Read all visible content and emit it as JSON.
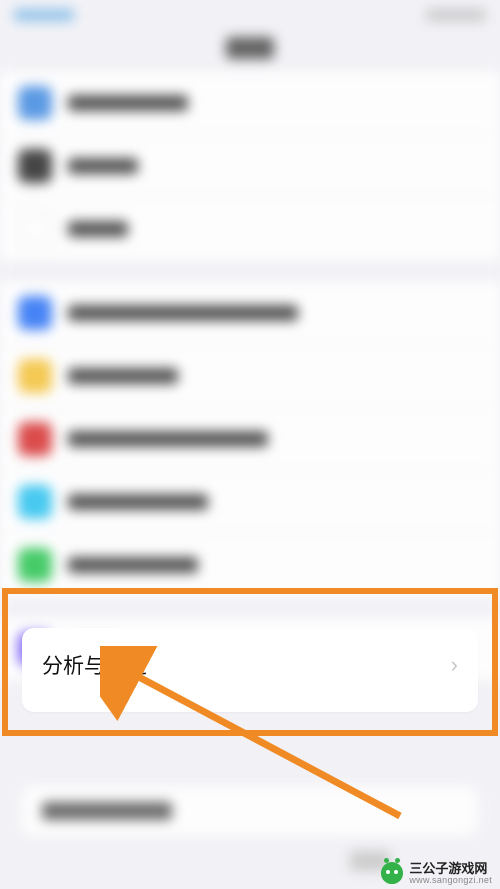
{
  "highlighted_item": {
    "label": "分析与改进",
    "chevron": "›"
  },
  "watermark": {
    "name": "三公子游戏网",
    "url": "www.sangongzi.net"
  },
  "annotation_color": "#f08a24"
}
